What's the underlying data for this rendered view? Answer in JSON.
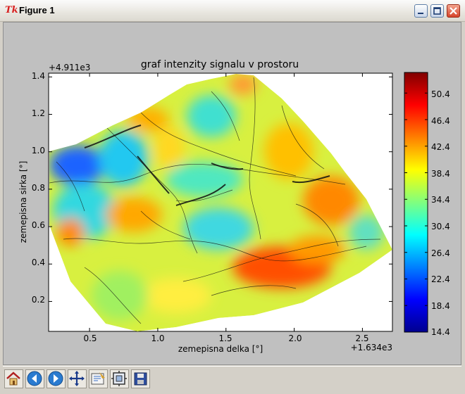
{
  "window": {
    "title": "Figure 1",
    "app_logo": "Tk"
  },
  "chart_data": {
    "type": "heatmap",
    "title": "graf intenzity signalu v prostoru",
    "xlabel": "zemepisna delka [°]",
    "ylabel": "zemepisna sirka [°]",
    "x_offset_label": "+1.634e3",
    "y_offset_label": "+4.911e3",
    "x_ticks": [
      "0.5",
      "1.0",
      "1.5",
      "2.0",
      "2.5"
    ],
    "y_ticks": [
      "0.2",
      "0.4",
      "0.6",
      "0.8",
      "1.0",
      "1.2",
      "1.4"
    ],
    "xlim": [
      0.2,
      2.72
    ],
    "ylim": [
      0.04,
      1.42
    ],
    "colorbar_ticks": [
      "14.4",
      "18.4",
      "22.4",
      "26.4",
      "30.4",
      "34.4",
      "38.4",
      "42.4",
      "46.4",
      "50.4"
    ],
    "colorbar_range": [
      14.4,
      53.5
    ],
    "colormap": "jet"
  },
  "toolbar": {
    "icons": [
      "home-icon",
      "back-icon",
      "forward-icon",
      "pan-icon",
      "zoom-icon",
      "subplots-icon",
      "save-icon"
    ]
  }
}
